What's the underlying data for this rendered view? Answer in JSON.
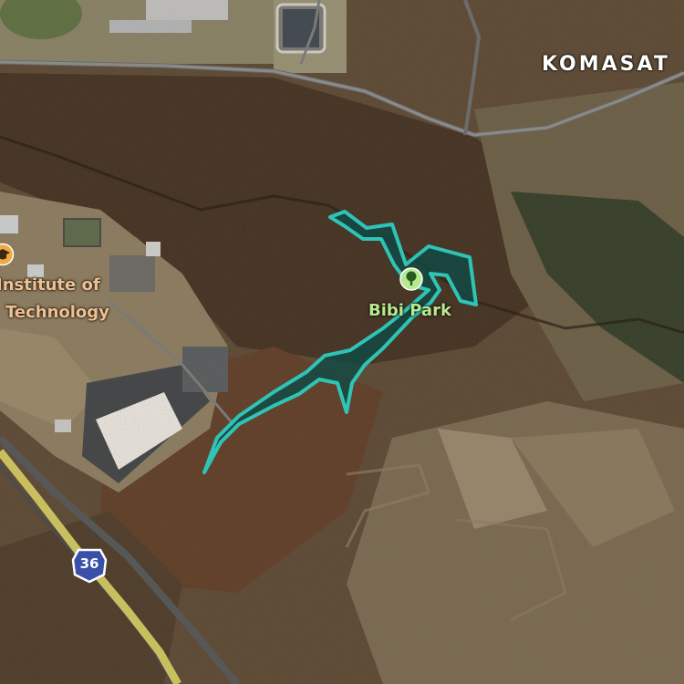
{
  "map": {
    "place_labels": {
      "district": "KOMASAT",
      "institute_line1": "Institute of",
      "institute_line2": "Technology",
      "park": "Bibi Park"
    },
    "road_shield": {
      "route_number": "36"
    },
    "icons": {
      "poi": "education-icon",
      "park": "tree-icon"
    },
    "colors": {
      "park_outline": "#2ec4b6",
      "park_fill": "#0f4a45",
      "label_text": "#f0c090",
      "park_label": "#b8e890",
      "district_label": "#ffffff",
      "shield": "#3a4fa8",
      "highway": "#c8c060"
    }
  }
}
